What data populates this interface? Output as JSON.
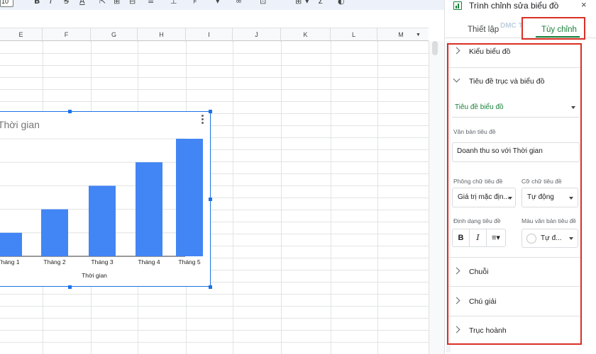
{
  "toolbar": {
    "zoom": "10",
    "items": [
      "B",
      "I",
      "S",
      "A",
      "⇱",
      "⊞",
      "⊟",
      "≡",
      "⊥",
      "⊧",
      "▾",
      "∞",
      "⊡",
      "⊞",
      "▾",
      "Σ",
      "◐"
    ]
  },
  "sheet": {
    "columns": [
      "E",
      "F",
      "G",
      "H",
      "I",
      "J",
      "K",
      "L",
      "M"
    ]
  },
  "chart": {
    "title_visible": "ới Thời gian",
    "xlabel": "Thời gian",
    "bar_color": "#4285f4"
  },
  "chart_data": {
    "type": "bar",
    "title": "Doanh thu so với Thời gian",
    "xlabel": "Thời gian",
    "categories": [
      "Tháng 1",
      "Tháng 2",
      "Tháng 3",
      "Tháng 4",
      "Tháng 5"
    ],
    "values": [
      1,
      2,
      3,
      4,
      5
    ],
    "ylim": [
      0,
      5
    ],
    "grid": true
  },
  "panel": {
    "title": "Trình chỉnh sửa biểu đồ",
    "close": "×",
    "tabs": {
      "setup": "Thiết lập",
      "customize": "Tùy chỉnh"
    },
    "watermark": "DMC T",
    "sections": {
      "chart_style": "Kiểu biểu đồ",
      "titles": "Tiêu đề trục và biểu đồ",
      "series": "Chuỗi",
      "legend": "Chú giải",
      "h_axis": "Trục hoành"
    },
    "title_type": "Tiêu đề biểu đồ",
    "title_text_label": "Văn bản tiêu đề",
    "title_text_value": "Doanh thu so với Thời gian",
    "font_label": "Phông chữ tiêu đề",
    "font_value": "Giá trị mặc địn...",
    "size_label": "Cỡ chữ tiêu đề",
    "size_value": "Tự động",
    "format_label": "Định dạng tiêu đề",
    "color_label": "Màu văn bản tiêu đề",
    "color_value": "Tự đ...",
    "format_bold": "B",
    "format_italic": "I",
    "format_align": "≡▾",
    "accent_color": "#188038",
    "highlight_color": "#d93025"
  }
}
